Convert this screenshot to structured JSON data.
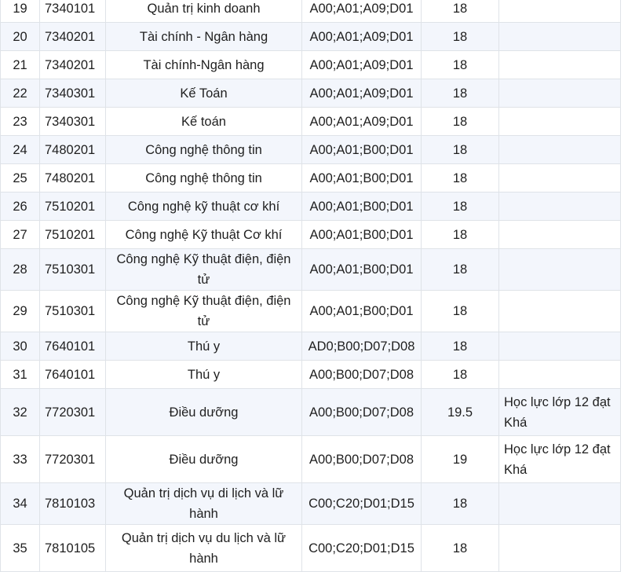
{
  "rows": [
    {
      "stt": "19",
      "code": "7340101",
      "name": "Quản trị kinh doanh",
      "combo": "A00;A01;A09;D01",
      "score": "18",
      "note": ""
    },
    {
      "stt": "20",
      "code": "7340201",
      "name": "Tài chính - Ngân hàng",
      "combo": "A00;A01;A09;D01",
      "score": "18",
      "note": ""
    },
    {
      "stt": "21",
      "code": "7340201",
      "name": "Tài chính-Ngân hàng",
      "combo": "A00;A01;A09;D01",
      "score": "18",
      "note": ""
    },
    {
      "stt": "22",
      "code": "7340301",
      "name": "Kế Toán",
      "combo": "A00;A01;A09;D01",
      "score": "18",
      "note": ""
    },
    {
      "stt": "23",
      "code": "7340301",
      "name": "Kế toán",
      "combo": "A00;A01;A09;D01",
      "score": "18",
      "note": ""
    },
    {
      "stt": "24",
      "code": "7480201",
      "name": "Công nghệ thông tin",
      "combo": "A00;A01;B00;D01",
      "score": "18",
      "note": ""
    },
    {
      "stt": "25",
      "code": "7480201",
      "name": "Công nghệ thông tin",
      "combo": "A00;A01;B00;D01",
      "score": "18",
      "note": ""
    },
    {
      "stt": "26",
      "code": "7510201",
      "name": "Công nghệ kỹ thuật cơ khí",
      "combo": "A00;A01;B00;D01",
      "score": "18",
      "note": ""
    },
    {
      "stt": "27",
      "code": "7510201",
      "name": "Công nghệ Kỹ thuật Cơ khí",
      "combo": "A00;A01;B00;D01",
      "score": "18",
      "note": ""
    },
    {
      "stt": "28",
      "code": "7510301",
      "name": "Công nghệ Kỹ thuật điện, điện tử",
      "combo": "A00;A01;B00;D01",
      "score": "18",
      "note": ""
    },
    {
      "stt": "29",
      "code": "7510301",
      "name": "Công nghệ Kỹ thuật điện, điện tử",
      "combo": "A00;A01;B00;D01",
      "score": "18",
      "note": ""
    },
    {
      "stt": "30",
      "code": "7640101",
      "name": "Thú y",
      "combo": "AD0;B00;D07;D08",
      "score": "18",
      "note": ""
    },
    {
      "stt": "31",
      "code": "7640101",
      "name": "Thú y",
      "combo": "A00;B00;D07;D08",
      "score": "18",
      "note": ""
    },
    {
      "stt": "32",
      "code": "7720301",
      "name": "Điều dưỡng",
      "combo": "A00;B00;D07;D08",
      "score": "19.5",
      "note": "Học lực lớp 12 đạt Khá"
    },
    {
      "stt": "33",
      "code": "7720301",
      "name": "Điều dưỡng",
      "combo": "A00;B00;D07;D08",
      "score": "19",
      "note": "Học lực lớp 12 đạt Khá"
    },
    {
      "stt": "34",
      "code": "7810103",
      "name": "Quản trị dịch vụ di lịch và lữ hành",
      "combo": "C00;C20;D01;D15",
      "score": "18",
      "note": ""
    },
    {
      "stt": "35",
      "code": "7810105",
      "name": "Quản trị dịch vụ du lịch và lữ hành",
      "combo": "C00;C20;D01;D15",
      "score": "18",
      "note": ""
    }
  ]
}
